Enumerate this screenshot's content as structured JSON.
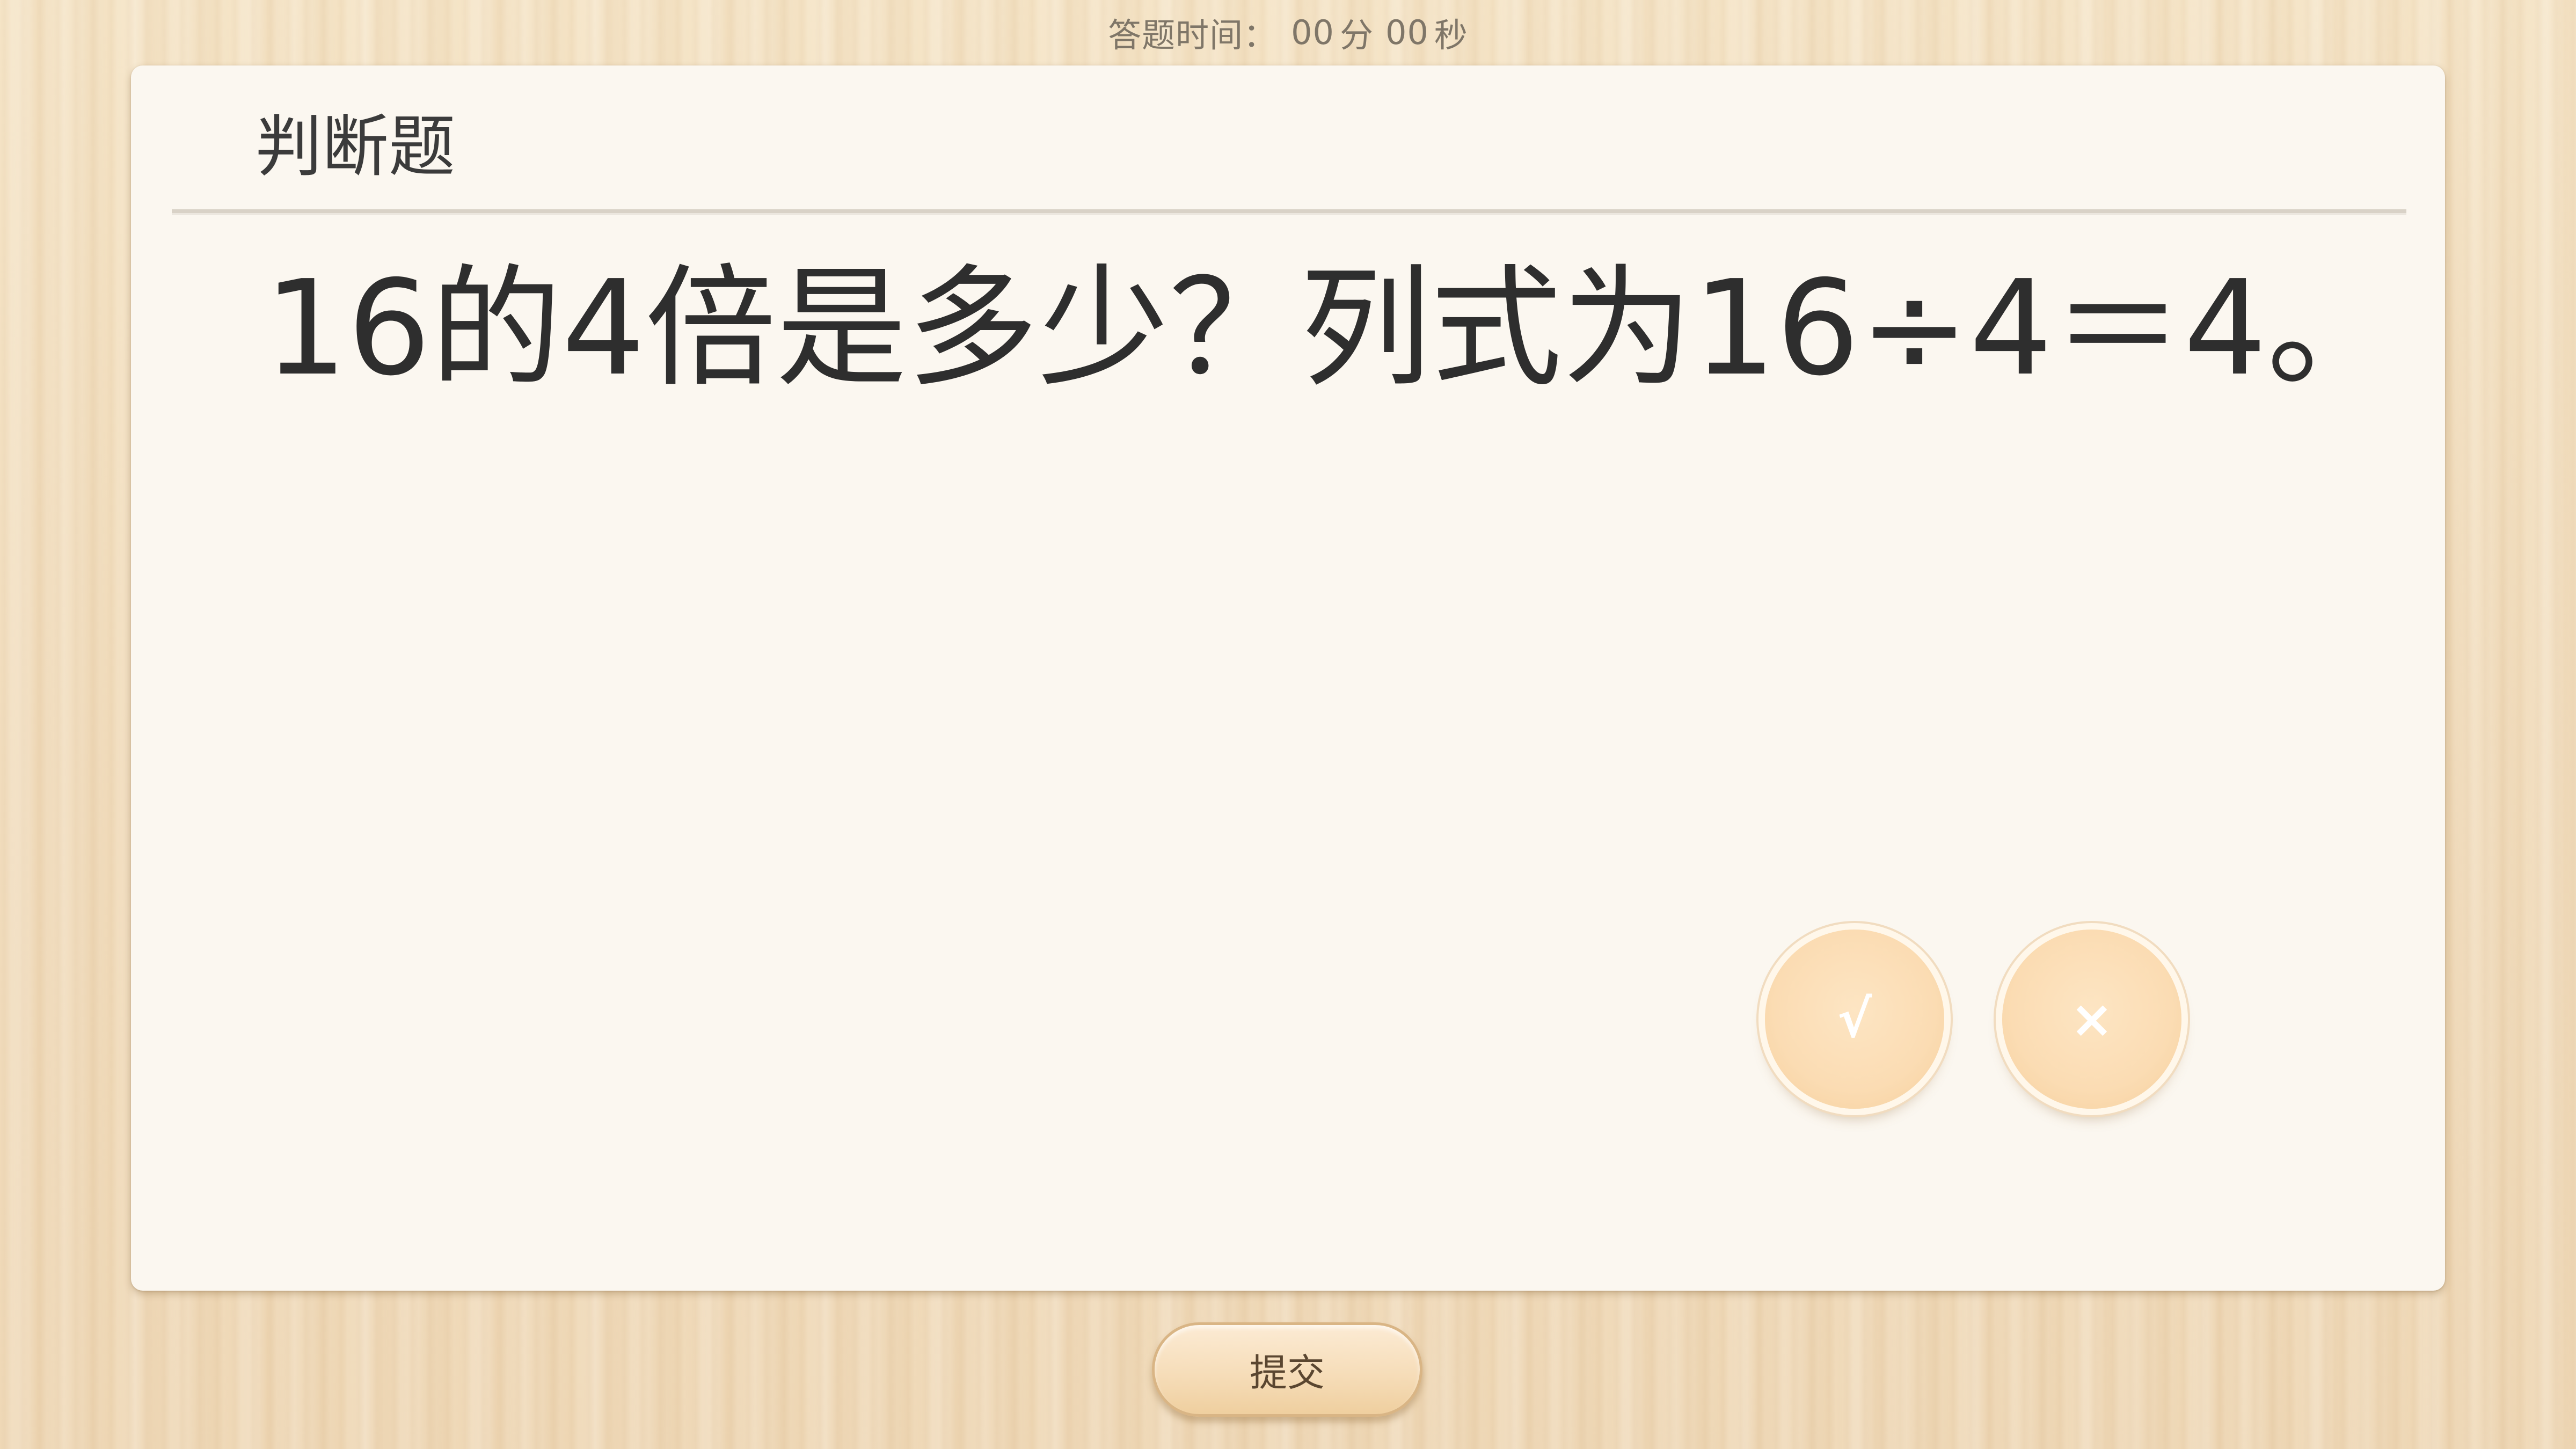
{
  "timer": {
    "label": "答题时间：",
    "minutes": "00",
    "minutes_unit": "分",
    "seconds": "00",
    "seconds_unit": "秒"
  },
  "question": {
    "type_label": "判断题",
    "text": "16的4倍是多少？列式为16÷4＝4。"
  },
  "answers": {
    "true_label": "√",
    "false_label": "×"
  },
  "submit": {
    "label": "提交"
  },
  "colors": {
    "card_background": "#fbf7f0",
    "answer_button": "#fbdcb3",
    "text_primary": "#2e2e2e"
  }
}
